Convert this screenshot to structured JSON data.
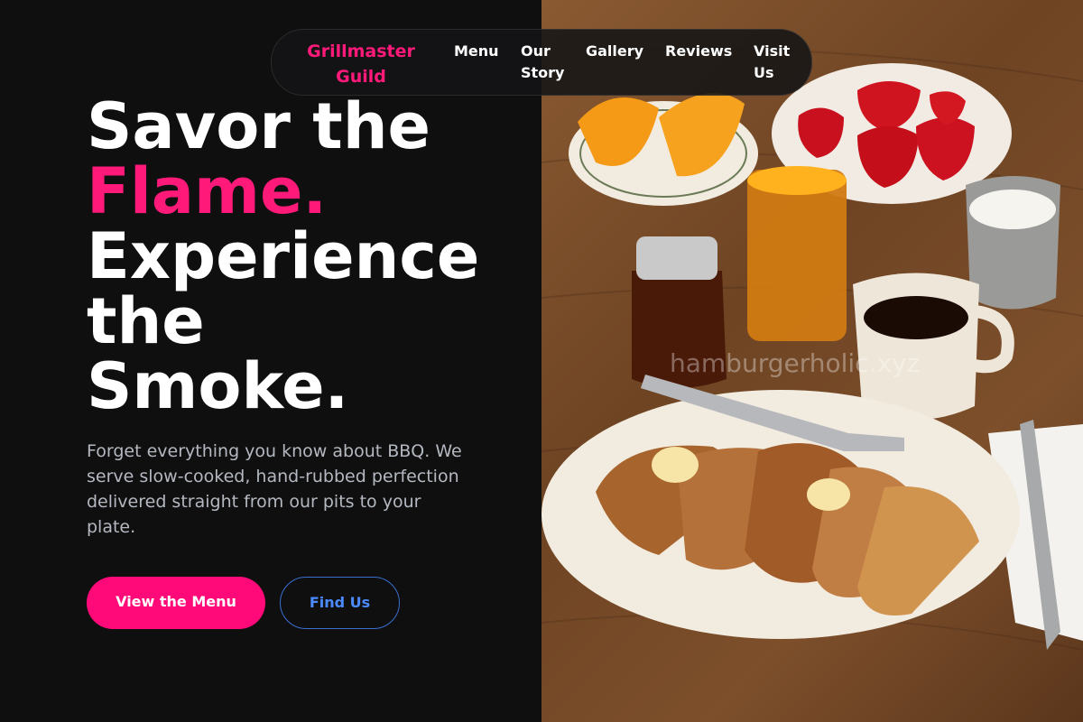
{
  "nav": {
    "brand": "Grillmaster Guild",
    "links": [
      "Menu",
      "Our Story",
      "Gallery",
      "Reviews",
      "Visit Us"
    ]
  },
  "hero": {
    "line1": "Savor the",
    "line2": "Flame.",
    "line3": "Experience",
    "line4": "the",
    "line5": "Smoke.",
    "description": "Forget everything you know about BBQ. We serve slow-cooked, hand-rubbed perfection delivered straight from our pits to your plate.",
    "primary_button": "View the Menu",
    "secondary_button": "Find Us"
  },
  "image": {
    "watermark": "hamburgerholic.xyz"
  },
  "colors": {
    "accent": "#ff1a7a",
    "background": "#0f0f10",
    "link_blue": "#4b8bff"
  }
}
